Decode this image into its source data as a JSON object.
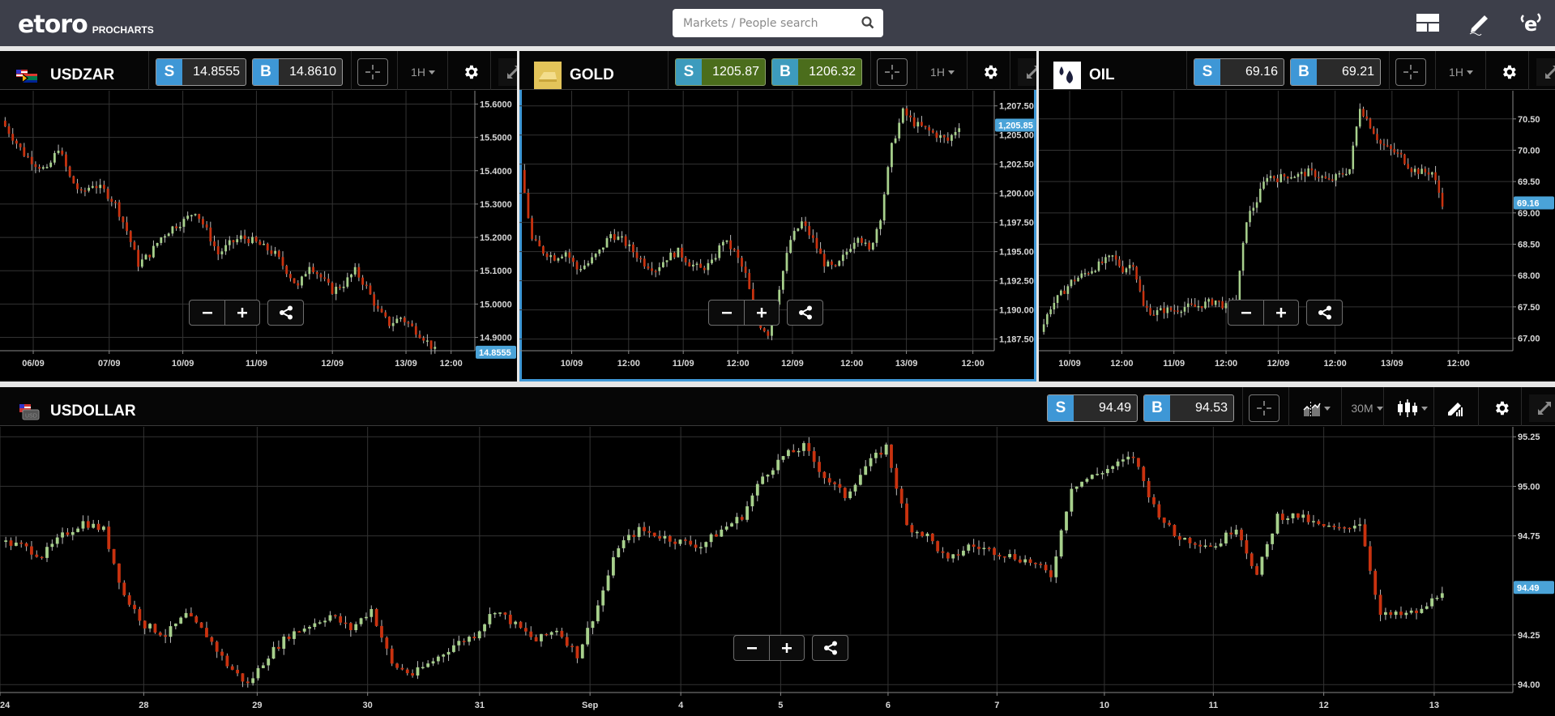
{
  "app": {
    "brand": "eToro",
    "product": "PROCHARTS",
    "search_placeholder": "Markets / People search",
    "top_icons": [
      "layout-icon",
      "edit-pencil-icon",
      "etoro-profile-icon"
    ]
  },
  "colors": {
    "accent": "#3e97d6",
    "up_candle": "#a7d08c",
    "down_candle": "#c9320f",
    "topbar": "#3d3f4a",
    "green_price": "#4b6d1c"
  },
  "panels": [
    {
      "id": "usdzar",
      "instrument": "USDZAR",
      "icon": "usd-zar-flag-icon",
      "sell_label": "S",
      "sell": "14.8555",
      "buy_label": "B",
      "buy": "14.8610",
      "timeframe": "1H",
      "active": false,
      "current_tag": "14.8555",
      "chart_data": {
        "type": "candlestick",
        "y_ticks": [
          "15.6000",
          "15.5000",
          "15.4000",
          "15.3000",
          "15.2000",
          "15.1000",
          "15.0000",
          "14.9000"
        ],
        "y_tick_values": [
          15.6,
          15.5,
          15.4,
          15.3,
          15.2,
          15.1,
          15.0,
          14.9
        ],
        "ylim": [
          14.86,
          15.64
        ],
        "x_ticks": [
          "06/09",
          "07/09",
          "10/09",
          "11/09",
          "12/09",
          "13/09",
          "12:00"
        ],
        "x_tick_pos": [
          0.07,
          0.23,
          0.385,
          0.54,
          0.7,
          0.855,
          0.95
        ],
        "last": 14.8555,
        "path": [
          15.55,
          15.5,
          15.45,
          15.42,
          15.4,
          15.47,
          15.38,
          15.33,
          15.36,
          15.34,
          15.3,
          15.22,
          15.12,
          15.15,
          15.2,
          15.23,
          15.25,
          15.28,
          15.22,
          15.15,
          15.18,
          15.2,
          15.19,
          15.17,
          15.15,
          15.1,
          15.05,
          15.12,
          15.08,
          15.04,
          15.06,
          15.1,
          15.05,
          14.98,
          14.94,
          14.96,
          14.93,
          14.9,
          14.86
        ]
      }
    },
    {
      "id": "gold",
      "instrument": "GOLD",
      "icon": "gold-bar-icon",
      "sell_label": "S",
      "sell": "1205.87",
      "buy_label": "B",
      "buy": "1206.32",
      "timeframe": "1H",
      "active": true,
      "current_tag": "1,205.85",
      "chart_data": {
        "type": "candlestick",
        "y_ticks": [
          "1,207.50",
          "1,205.00",
          "1,202.50",
          "1,200.00",
          "1,197.50",
          "1,195.00",
          "1,192.50",
          "1,190.00",
          "1,187.50"
        ],
        "y_tick_values": [
          1207.5,
          1205,
          1202.5,
          1200,
          1197.5,
          1195,
          1192.5,
          1190,
          1187.5
        ],
        "ylim": [
          1186.5,
          1208.8
        ],
        "x_ticks": [
          "10/09",
          "12:00",
          "11/09",
          "12:00",
          "12/09",
          "12:00",
          "13/09",
          "12:00"
        ],
        "x_tick_pos": [
          0.11,
          0.23,
          0.345,
          0.46,
          0.575,
          0.7,
          0.815,
          0.955
        ],
        "last": 1205.85,
        "path": [
          1202,
          1196,
          1195,
          1194.5,
          1195,
          1193.5,
          1194,
          1195,
          1196.5,
          1196,
          1195,
          1194,
          1193.5,
          1194.5,
          1195,
          1194,
          1193.5,
          1194,
          1196,
          1195,
          1193,
          1189,
          1188,
          1192,
          1196,
          1197.5,
          1196,
          1194,
          1193.5,
          1195,
          1196.5,
          1195,
          1198,
          1204,
          1207,
          1206,
          1205.5,
          1205,
          1204.5,
          1205.85
        ]
      }
    },
    {
      "id": "oil",
      "instrument": "OIL",
      "icon": "oil-drops-icon",
      "sell_label": "S",
      "sell": "69.16",
      "buy_label": "B",
      "buy": "69.21",
      "timeframe": "1H",
      "active": false,
      "current_tag": "69.16",
      "chart_data": {
        "type": "candlestick",
        "y_ticks": [
          "70.50",
          "70.00",
          "69.50",
          "69.00",
          "68.50",
          "68.00",
          "67.50",
          "67.00"
        ],
        "y_tick_values": [
          70.5,
          70.0,
          69.5,
          69.0,
          68.5,
          68.0,
          67.5,
          67.0
        ],
        "ylim": [
          66.8,
          70.95
        ],
        "x_ticks": [
          "10/09",
          "12:00",
          "11/09",
          "12:00",
          "12/09",
          "12:00",
          "13/09",
          "12:00"
        ],
        "x_tick_pos": [
          0.065,
          0.175,
          0.285,
          0.395,
          0.505,
          0.625,
          0.745,
          0.885
        ],
        "last": 69.16,
        "path": [
          67.1,
          67.5,
          67.7,
          67.9,
          68.0,
          68.1,
          68.2,
          68.3,
          68.1,
          68.2,
          67.5,
          67.4,
          67.45,
          67.45,
          67.5,
          67.5,
          67.55,
          67.6,
          67.5,
          67.6,
          68.9,
          69.2,
          69.6,
          69.55,
          69.6,
          69.6,
          69.65,
          69.6,
          69.5,
          69.6,
          69.7,
          70.7,
          70.4,
          70.1,
          70.0,
          69.9,
          69.7,
          69.65,
          69.65,
          69.16
        ]
      }
    },
    {
      "id": "usdollar",
      "instrument": "USDOLLAR",
      "icon": "usd-index-flag-icon",
      "sell_label": "S",
      "sell": "94.49",
      "buy_label": "B",
      "buy": "94.53",
      "timeframe": "30M",
      "active": false,
      "current_tag": "94.49",
      "chart_data": {
        "type": "candlestick",
        "y_ticks": [
          "95.25",
          "95.00",
          "94.75",
          "94.25",
          "94.00"
        ],
        "y_tick_values": [
          95.25,
          95.0,
          94.75,
          94.25,
          94.0
        ],
        "ylim": [
          93.96,
          95.3
        ],
        "x_ticks": [
          "24",
          "28",
          "29",
          "30",
          "31",
          "Sep",
          "4",
          "5",
          "6",
          "7",
          "10",
          "11",
          "12",
          "13"
        ],
        "x_tick_pos": [
          0.0,
          0.095,
          0.17,
          0.243,
          0.317,
          0.39,
          0.45,
          0.516,
          0.587,
          0.659,
          0.73,
          0.802,
          0.875,
          0.948
        ],
        "last": 94.49,
        "path": [
          94.72,
          94.7,
          94.65,
          94.75,
          94.82,
          94.78,
          94.45,
          94.3,
          94.25,
          94.35,
          94.25,
          94.1,
          94.0,
          94.15,
          94.25,
          94.3,
          94.35,
          94.28,
          94.38,
          94.1,
          94.05,
          94.12,
          94.2,
          94.25,
          94.38,
          94.3,
          94.22,
          94.28,
          94.15,
          94.4,
          94.7,
          94.78,
          94.75,
          94.72,
          94.7,
          94.78,
          94.85,
          95.05,
          95.15,
          95.2,
          95.05,
          94.95,
          95.1,
          95.2,
          94.8,
          94.75,
          94.62,
          94.7,
          94.68,
          94.65,
          94.62,
          94.55,
          95.0,
          95.05,
          95.1,
          95.15,
          94.9,
          94.75,
          94.72,
          94.7,
          94.8,
          94.55,
          94.85,
          94.85,
          94.8,
          94.78,
          94.82,
          94.35,
          94.35,
          94.37,
          94.48
        ]
      }
    }
  ],
  "usdollar_tools": [
    "crosshair-icon",
    "compare-icon",
    "timeframe-30M",
    "candle-type-icon",
    "drawing-tools-icon",
    "settings-gear-icon",
    "expand-icon"
  ],
  "zoom_controls": {
    "zoom_out": "−",
    "zoom_in": "+"
  }
}
